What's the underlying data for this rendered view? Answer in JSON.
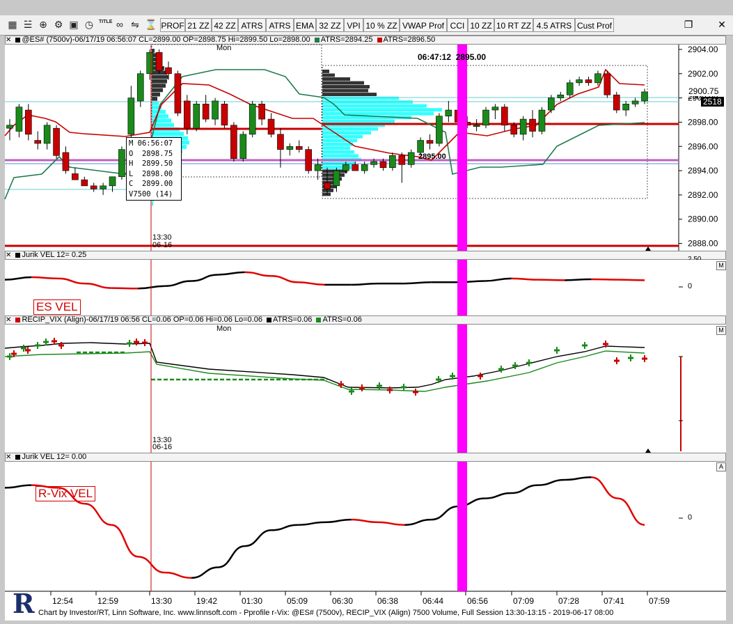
{
  "toolbar": {
    "icons": [
      "chart-bars-icon",
      "settings-bars-icon",
      "zoom-icon",
      "gear-icon",
      "camera-icon",
      "alarm-clock-icon",
      "title-icon",
      "link-icon",
      "scale-icon",
      "hourglass-icon"
    ],
    "title_icon_text": "TITLE",
    "buttons": [
      "PROF",
      "21 ZZ",
      "42 ZZ",
      "ATRS",
      "ATRS",
      "EMA",
      "32 ZZ",
      "VPI",
      "10 % ZZ",
      "VWAP Prof",
      "CCI",
      "10 ZZ",
      "10 RT ZZ",
      "4.5 ATRS",
      "Cust Prof"
    ]
  },
  "panel1": {
    "header_main": "@ES# (7500v)-06/17/19 06:56:07 CL=2899.00 OP=2898.75 Hi=2899.50 Lo=2898.00",
    "header_atrs1": "ATRS=2894.25",
    "header_atrs2": "ATRS=2896.50",
    "day_label": "Mon",
    "cursor_label": "06:47:12  2895.00",
    "profile_label": "2895.00",
    "session_time": "13:30",
    "session_date": "06-16",
    "price_tag": "2900.75",
    "volume_tag": "2518",
    "price_tag_partial": "290"
  },
  "ohlc": {
    "m": "M 06:56:07",
    "o": "O  2898.75",
    "h": "H  2899.50",
    "l": "L  2898.00",
    "c": "C  2899.00",
    "v": "V7500 (14)"
  },
  "panel2": {
    "header": "Jurik VEL 12= 0.25",
    "tag": "ES VEL",
    "zero": "0",
    "partial_tick": "2.50"
  },
  "panel3": {
    "header_main": "RECIP_VIX (Align)-06/17/19 06:56 CL=0.06 OP=0.06 Hi=0.06 Lo=0.06",
    "header_atrs1": "ATRS=0.06",
    "header_atrs2": "ATRS=0.06",
    "day_label": "Mon",
    "session_time": "13:30",
    "session_date": "06-16"
  },
  "panel4": {
    "header": "Jurik VEL 12= 0.00",
    "tag": "R-Vix VEL",
    "zero": "0",
    "corner": "A"
  },
  "corner_btn": "M",
  "logo_letter": "R",
  "footer": "Chart by Investor/RT, Linn Software, Inc. www.linnsoft.com - Pprofile r-Vix: @ES# (7500v), RECIP_VIX (Align) 7500 Volume, Full Session 13:30-13:15 - 2019-06-17 08:00",
  "colors": {
    "up": "#1a8a1a",
    "down": "#c80000",
    "magenta": "#ff00ff",
    "cyan": "#33ffff",
    "purple": "#c060c0",
    "dark_green_line": "#1e7a4e"
  },
  "chart_data": [
    {
      "type": "candlestick",
      "title": "@ES# (7500v)",
      "y_ticks": [
        2904.0,
        2902.0,
        2900.0,
        2898.0,
        2896.0,
        2894.0,
        2892.0,
        2890.0,
        2888.0
      ],
      "ylim": [
        2887.4,
        2904.4
      ],
      "x_tick_labels": [
        "12:54",
        "12:59",
        "13:30",
        "19:42",
        "01:30",
        "05:09",
        "06:30",
        "06:38",
        "06:44",
        "06:56",
        "07:09",
        "07:28",
        "07:41",
        "07:59"
      ],
      "last_price": 2900.75,
      "candles": [
        {
          "o": 2897.5,
          "h": 2898.25,
          "l": 2896.5,
          "c": 2897.75
        },
        {
          "o": 2897.25,
          "h": 2899.5,
          "l": 2896.75,
          "c": 2899.25
        },
        {
          "o": 2899.0,
          "h": 2899.5,
          "l": 2896.5,
          "c": 2897.0
        },
        {
          "o": 2896.5,
          "h": 2897.25,
          "l": 2895.75,
          "c": 2896.25
        },
        {
          "o": 2896.25,
          "h": 2898.0,
          "l": 2895.75,
          "c": 2897.75
        },
        {
          "o": 2897.5,
          "h": 2897.75,
          "l": 2895.0,
          "c": 2895.25
        },
        {
          "o": 2895.5,
          "h": 2896.0,
          "l": 2893.75,
          "c": 2894.0
        },
        {
          "o": 2893.75,
          "h": 2894.25,
          "l": 2893.25,
          "c": 2893.25
        },
        {
          "o": 2893.25,
          "h": 2893.5,
          "l": 2892.75,
          "c": 2892.75
        },
        {
          "o": 2892.75,
          "h": 2893.0,
          "l": 2892.25,
          "c": 2892.5
        },
        {
          "o": 2892.5,
          "h": 2893.0,
          "l": 2892.0,
          "c": 2892.75
        },
        {
          "o": 2892.75,
          "h": 2893.5,
          "l": 2892.25,
          "c": 2893.5
        },
        {
          "o": 2893.5,
          "h": 2896.0,
          "l": 2893.25,
          "c": 2895.75
        },
        {
          "o": 2897.0,
          "h": 2901.0,
          "l": 2896.5,
          "c": 2900.0
        },
        {
          "o": 2899.75,
          "h": 2902.25,
          "l": 2899.25,
          "c": 2902.0
        },
        {
          "o": 2902.0,
          "h": 2904.0,
          "l": 2901.5,
          "c": 2903.75
        },
        {
          "o": 2903.75,
          "h": 2904.0,
          "l": 2902.0,
          "c": 2902.25
        },
        {
          "o": 2902.5,
          "h": 2903.0,
          "l": 2901.5,
          "c": 2902.0
        },
        {
          "o": 2902.0,
          "h": 2902.25,
          "l": 2898.5,
          "c": 2898.75
        },
        {
          "o": 2899.75,
          "h": 2900.25,
          "l": 2897.0,
          "c": 2897.5
        },
        {
          "o": 2897.5,
          "h": 2899.75,
          "l": 2897.25,
          "c": 2899.5
        },
        {
          "o": 2899.5,
          "h": 2900.25,
          "l": 2898.0,
          "c": 2898.25
        },
        {
          "o": 2898.25,
          "h": 2900.0,
          "l": 2897.75,
          "c": 2899.75
        },
        {
          "o": 2899.5,
          "h": 2899.75,
          "l": 2897.5,
          "c": 2897.75
        },
        {
          "o": 2897.75,
          "h": 2898.0,
          "l": 2894.75,
          "c": 2895.0
        },
        {
          "o": 2895.0,
          "h": 2897.25,
          "l": 2894.75,
          "c": 2897.0
        },
        {
          "o": 2897.0,
          "h": 2899.75,
          "l": 2896.75,
          "c": 2899.5
        },
        {
          "o": 2899.5,
          "h": 2899.75,
          "l": 2897.75,
          "c": 2898.25
        },
        {
          "o": 2898.25,
          "h": 2898.75,
          "l": 2896.75,
          "c": 2897.0
        },
        {
          "o": 2897.0,
          "h": 2897.5,
          "l": 2894.25,
          "c": 2895.75
        },
        {
          "o": 2895.75,
          "h": 2896.25,
          "l": 2895.25,
          "c": 2896.0
        },
        {
          "o": 2896.0,
          "h": 2896.5,
          "l": 2895.5,
          "c": 2895.75
        },
        {
          "o": 2895.75,
          "h": 2896.0,
          "l": 2893.75,
          "c": 2894.0
        },
        {
          "o": 2894.0,
          "h": 2895.0,
          "l": 2893.25,
          "c": 2894.5
        },
        {
          "o": 2893.0,
          "h": 2894.25,
          "l": 2892.0,
          "c": 2892.5
        },
        {
          "o": 2892.75,
          "h": 2894.25,
          "l": 2892.25,
          "c": 2894.0
        },
        {
          "o": 2894.0,
          "h": 2894.75,
          "l": 2893.75,
          "c": 2894.5
        },
        {
          "o": 2894.5,
          "h": 2894.75,
          "l": 2894.0,
          "c": 2894.0
        },
        {
          "o": 2894.0,
          "h": 2894.75,
          "l": 2893.75,
          "c": 2894.5
        },
        {
          "o": 2894.5,
          "h": 2895.0,
          "l": 2894.25,
          "c": 2894.75
        },
        {
          "o": 2894.75,
          "h": 2895.0,
          "l": 2894.0,
          "c": 2894.25
        },
        {
          "o": 2894.25,
          "h": 2895.5,
          "l": 2894.0,
          "c": 2895.25
        },
        {
          "o": 2895.25,
          "h": 2895.5,
          "l": 2893.0,
          "c": 2894.5
        },
        {
          "o": 2894.5,
          "h": 2895.75,
          "l": 2894.25,
          "c": 2895.5
        },
        {
          "o": 2895.5,
          "h": 2896.75,
          "l": 2895.25,
          "c": 2896.5
        },
        {
          "o": 2896.5,
          "h": 2897.0,
          "l": 2895.75,
          "c": 2896.25
        },
        {
          "o": 2896.25,
          "h": 2898.75,
          "l": 2896.0,
          "c": 2898.5
        },
        {
          "o": 2898.5,
          "h": 2899.75,
          "l": 2898.0,
          "c": 2899.0
        },
        {
          "o": 2899.0,
          "h": 2899.5,
          "l": 2897.75,
          "c": 2898.0
        },
        {
          "o": 2898.0,
          "h": 2898.5,
          "l": 2897.5,
          "c": 2897.75
        },
        {
          "o": 2897.75,
          "h": 2898.25,
          "l": 2897.25,
          "c": 2897.75
        },
        {
          "o": 2897.75,
          "h": 2899.25,
          "l": 2897.5,
          "c": 2899.0
        },
        {
          "o": 2899.0,
          "h": 2899.5,
          "l": 2898.25,
          "c": 2899.25
        },
        {
          "o": 2899.25,
          "h": 2899.5,
          "l": 2897.25,
          "c": 2897.75
        },
        {
          "o": 2897.75,
          "h": 2898.0,
          "l": 2896.75,
          "c": 2897.0
        },
        {
          "o": 2897.0,
          "h": 2898.5,
          "l": 2896.5,
          "c": 2898.25
        },
        {
          "o": 2898.25,
          "h": 2899.0,
          "l": 2896.75,
          "c": 2897.25
        },
        {
          "o": 2897.25,
          "h": 2899.25,
          "l": 2897.0,
          "c": 2899.0
        },
        {
          "o": 2899.0,
          "h": 2900.25,
          "l": 2898.75,
          "c": 2900.0
        },
        {
          "o": 2900.0,
          "h": 2900.5,
          "l": 2899.75,
          "c": 2900.25
        },
        {
          "o": 2900.25,
          "h": 2901.5,
          "l": 2900.0,
          "c": 2901.25
        },
        {
          "o": 2901.25,
          "h": 2901.75,
          "l": 2901.0,
          "c": 2901.5
        },
        {
          "o": 2901.5,
          "h": 2901.75,
          "l": 2901.0,
          "c": 2901.25
        },
        {
          "o": 2901.25,
          "h": 2902.25,
          "l": 2901.0,
          "c": 2902.0
        },
        {
          "o": 2902.0,
          "h": 2902.25,
          "l": 2900.0,
          "c": 2900.25
        },
        {
          "o": 2900.25,
          "h": 2900.5,
          "l": 2898.75,
          "c": 2899.0
        },
        {
          "o": 2899.0,
          "h": 2899.75,
          "l": 2898.5,
          "c": 2899.5
        },
        {
          "o": 2899.5,
          "h": 2900.0,
          "l": 2899.25,
          "c": 2899.75
        },
        {
          "o": 2899.75,
          "h": 2900.75,
          "l": 2899.5,
          "c": 2900.5
        }
      ]
    },
    {
      "type": "line",
      "title": "Jurik VEL 12",
      "ylim": [
        -1.2,
        0.6
      ],
      "series": [
        {
          "name": "Jurik VEL 12",
          "values": [
            0.0,
            0.1,
            0.05,
            -0.15,
            -0.33,
            -0.35,
            -0.25,
            -0.05,
            0.2,
            0.3,
            0.15,
            -0.1,
            -0.2,
            -0.2,
            -0.15,
            -0.15,
            -0.1,
            -0.1,
            -0.05,
            0.05,
            0.0,
            -0.02,
            0.02,
            0.0,
            -0.02
          ]
        }
      ]
    },
    {
      "type": "line",
      "title": "RECIP_VIX (Align)",
      "series": [
        {
          "name": "ATRS",
          "values": [
            0.06,
            0.061,
            0.061,
            0.061,
            0.055,
            0.054,
            0.053,
            0.052,
            0.051,
            0.05,
            0.05,
            0.051,
            0.053,
            0.055,
            0.056,
            0.057,
            0.058
          ]
        },
        {
          "name": "ATRS",
          "values": [
            0.058,
            0.059,
            0.059,
            0.059,
            0.056,
            0.055,
            0.054,
            0.053,
            0.052,
            0.05,
            0.05,
            0.05,
            0.052,
            0.054,
            0.055,
            0.056,
            0.057
          ]
        }
      ]
    },
    {
      "type": "line",
      "title": "Jurik VEL 12",
      "series": [
        {
          "name": "Jurik VEL 12",
          "values": [
            0.4,
            0.45,
            0.4,
            0.1,
            -0.3,
            -0.9,
            -1.2,
            -1.3,
            -1.1,
            -0.7,
            -0.4,
            -0.3,
            -0.25,
            -0.2,
            -0.25,
            -0.3,
            -0.2,
            0.05,
            0.2,
            0.3,
            0.45,
            0.55,
            0.6,
            0.2,
            -0.3
          ]
        }
      ]
    }
  ]
}
